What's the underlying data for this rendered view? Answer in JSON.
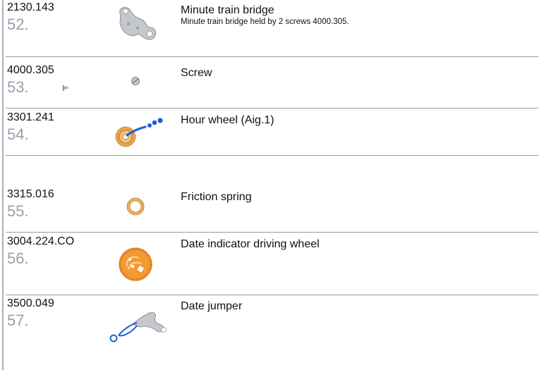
{
  "parts": [
    {
      "ref": "2130.143",
      "num": "52.",
      "title": "Minute train bridge",
      "desc": "Minute train bridge held by 2 screws 4000.305.",
      "icon": "bridge-icon"
    },
    {
      "ref": "4000.305",
      "num": "53.",
      "title": "Screw",
      "desc": "",
      "icon": "screw-icon"
    },
    {
      "ref": "3301.241",
      "num": "54.",
      "title": "Hour wheel (Aig.1)",
      "desc": "",
      "icon": "hour-wheel-icon"
    },
    {
      "ref": "3315.016",
      "num": "55.",
      "title": "Friction spring",
      "desc": "",
      "icon": "friction-spring-icon"
    },
    {
      "ref": "3004.224.CO",
      "num": "56.",
      "title": "Date indicator driving wheel",
      "desc": "",
      "icon": "date-driving-wheel-icon"
    },
    {
      "ref": "3500.049",
      "num": "57.",
      "title": "Date jumper",
      "desc": "",
      "icon": "date-jumper-icon"
    }
  ],
  "colors": {
    "accent_blue": "#1f5fd8",
    "gold": "#e0a040",
    "orange": "#f08a1a",
    "steel": "#b8bcc2"
  }
}
